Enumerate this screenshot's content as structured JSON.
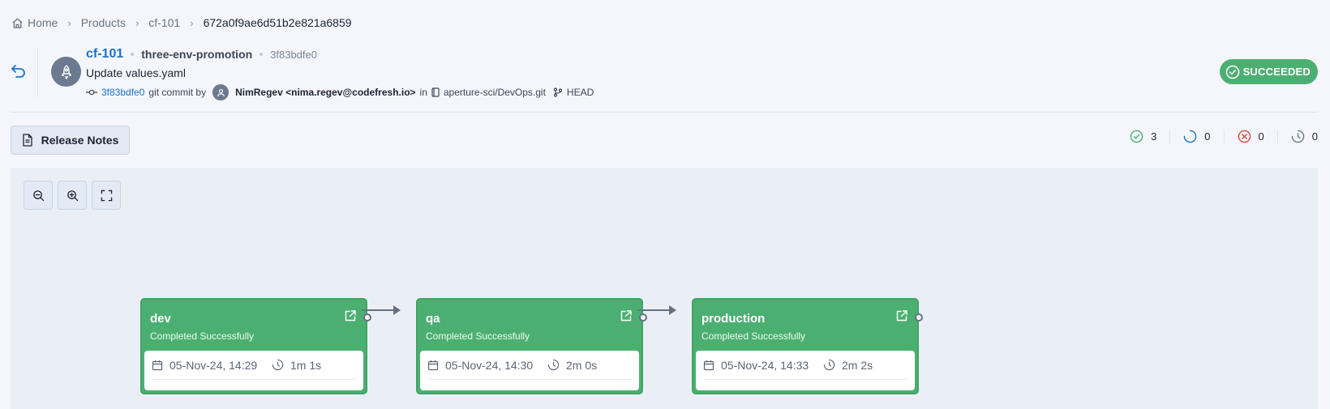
{
  "breadcrumb": {
    "items": [
      "Home",
      "Products",
      "cf-101"
    ],
    "current": "672a0f9ae6d51b2e821a6859"
  },
  "header": {
    "app_name": "cf-101",
    "pipeline": "three-env-promotion",
    "sha": "3f83bdfe0",
    "commit_message": "Update values.yaml",
    "commit_sha": "3f83bdfe0",
    "commit_text": "git commit by",
    "author": "NimRegev <nima.regev@codefresh.io>",
    "in_text": "in",
    "repo": "aperture-sci/DevOps.git",
    "ref": "HEAD"
  },
  "status": {
    "label": "SUCCEEDED",
    "color": "#4caf72"
  },
  "toolbar": {
    "release_notes_label": "Release Notes"
  },
  "counters": {
    "succeeded": "3",
    "running": "0",
    "failed": "0",
    "pending": "0"
  },
  "canvas": {
    "zoom_out_icon": "zoom-out-icon",
    "zoom_in_icon": "zoom-in-icon",
    "fit_icon": "fit-screen-icon"
  },
  "environments": [
    {
      "name": "dev",
      "status": "Completed Successfully",
      "date": "05-Nov-24, 14:29",
      "duration": "1m 1s"
    },
    {
      "name": "qa",
      "status": "Completed Successfully",
      "date": "05-Nov-24, 14:30",
      "duration": "2m 0s"
    },
    {
      "name": "production",
      "status": "Completed Successfully",
      "date": "05-Nov-24, 14:33",
      "duration": "2m 2s"
    }
  ],
  "colors": {
    "accent": "#1a73c8",
    "success": "#4caf72",
    "failed": "#e0453a",
    "neutral": "#6b7a90"
  }
}
